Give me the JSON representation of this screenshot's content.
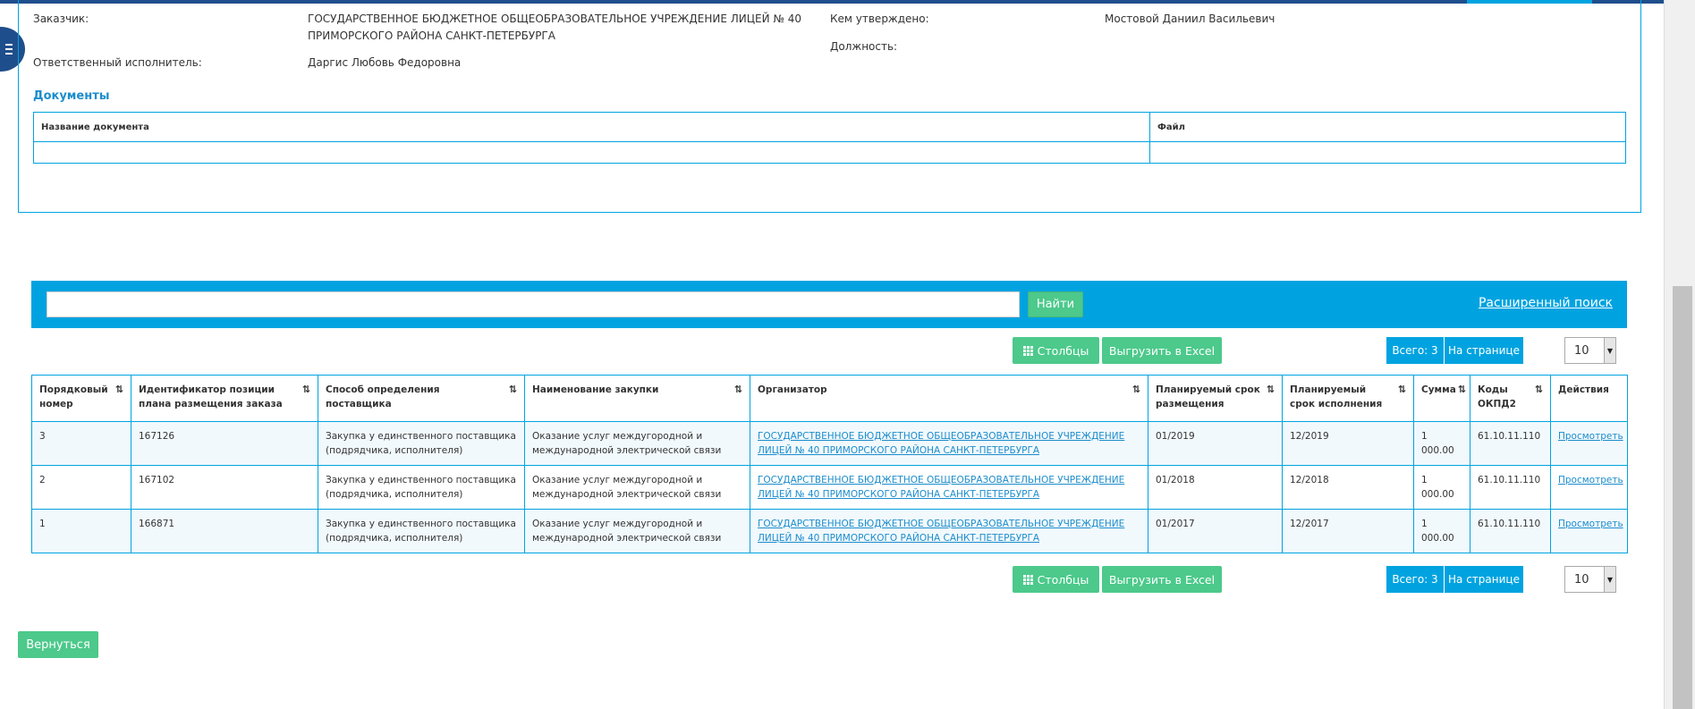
{
  "info": {
    "customer_label": "Заказчик:",
    "customer_value_line1": "ГОСУДАРСТВЕННОЕ БЮДЖЕТНОЕ ОБЩЕОБРАЗОВАТЕЛЬНОЕ УЧРЕЖДЕНИЕ ЛИЦЕЙ № 40",
    "customer_value_line2": "ПРИМОРСКОГО РАЙОНА САНКТ-ПЕТЕРБУРГА",
    "executor_label": "Ответственный исполнитель:",
    "executor_value": "Даргис Любовь Федоровна",
    "approved_label": "Кем утверждено:",
    "approved_value": "Мостовой Даниил Васильевич",
    "position_label": "Должность:"
  },
  "documents": {
    "title": "Документы",
    "columns": [
      "Название документа",
      "Файл"
    ]
  },
  "search": {
    "placeholder": "",
    "find_label": "Найти",
    "advanced_label": "Расширенный поиск"
  },
  "toolbar": {
    "columns_label": "Столбцы",
    "excel_label": "Выгрузить в Excel",
    "total_label": "Всего: 3",
    "per_page_label": "На странице",
    "per_page_value": "10"
  },
  "results": {
    "columns": [
      "Порядковый номер",
      "Идентификатор позиции плана размещения заказа",
      "Способ определения поставщика",
      "Наименование закупки",
      "Организатор",
      "Планируемый срок размещения",
      "Планируемый срок исполнения",
      "Сумма",
      "Коды ОКПД2",
      "Действия"
    ],
    "rows": [
      {
        "num": "3",
        "id": "167126",
        "method": "Закупка у единственного поставщика (подрядчика, исполнителя)",
        "name": "Оказание услуг междугородной и международной электрической связи",
        "organizer": "ГОСУДАРСТВЕННОЕ БЮДЖЕТНОЕ ОБЩЕОБРАЗОВАТЕЛЬНОЕ УЧРЕЖДЕНИЕ ЛИЦЕЙ № 40 ПРИМОРСКОГО РАЙОНА САНКТ-ПЕТЕРБУРГА",
        "placement": "01/2019",
        "execution": "12/2019",
        "sum": "1 000.00",
        "okpd": "61.10.11.110",
        "action": "Просмотреть"
      },
      {
        "num": "2",
        "id": "167102",
        "method": "Закупка у единственного поставщика (подрядчика, исполнителя)",
        "name": "Оказание услуг междугородной и международной электрической связи",
        "organizer": "ГОСУДАРСТВЕННОЕ БЮДЖЕТНОЕ ОБЩЕОБРАЗОВАТЕЛЬНОЕ УЧРЕЖДЕНИЕ ЛИЦЕЙ № 40 ПРИМОРСКОГО РАЙОНА САНКТ-ПЕТЕРБУРГА",
        "placement": "01/2018",
        "execution": "12/2018",
        "sum": "1 000.00",
        "okpd": "61.10.11.110",
        "action": "Просмотреть"
      },
      {
        "num": "1",
        "id": "166871",
        "method": "Закупка у единственного поставщика (подрядчика, исполнителя)",
        "name": "Оказание услуг междугородной и международной электрической связи",
        "organizer": "ГОСУДАРСТВЕННОЕ БЮДЖЕТНОЕ ОБЩЕОБРАЗОВАТЕЛЬНОЕ УЧРЕЖДЕНИЕ ЛИЦЕЙ № 40 ПРИМОРСКОГО РАЙОНА САНКТ-ПЕТЕРБУРГА",
        "placement": "01/2017",
        "execution": "12/2017",
        "sum": "1 000.00",
        "okpd": "61.10.11.110",
        "action": "Просмотреть"
      }
    ]
  },
  "back_label": "Вернуться",
  "colors": {
    "accent": "#00a3e0",
    "primary_dark": "#1f4e8c",
    "green": "#4cc98b",
    "link": "#1c8dcc"
  }
}
